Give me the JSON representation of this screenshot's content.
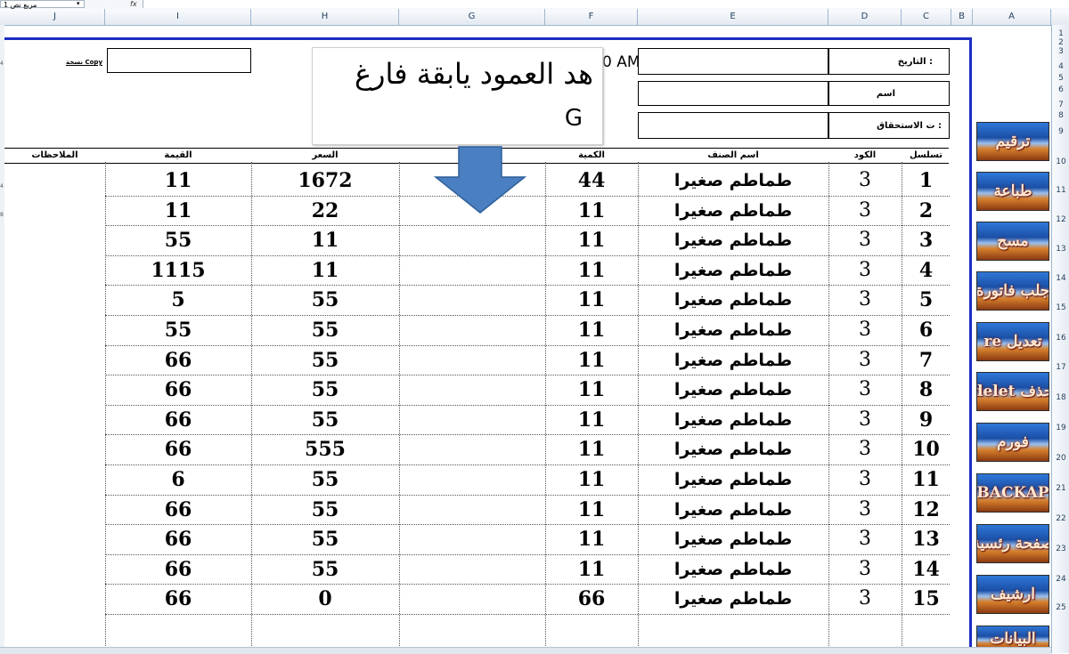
{
  "formula_bar": {
    "name_box": "مربع نص 1",
    "fx": "fx"
  },
  "columns": [
    "J",
    "I",
    "H",
    "G",
    "F",
    "E",
    "D",
    "C",
    "B",
    "A"
  ],
  "rows": [
    "1",
    "2",
    "3",
    "4",
    "5",
    "6",
    "7",
    "8",
    "9",
    "10",
    "11",
    "12",
    "13",
    "14",
    "15",
    "16",
    "17",
    "18",
    "19",
    "20",
    "21",
    "22",
    "23",
    "24",
    "25"
  ],
  "left_markers": [
    "4",
    "4",
    "8"
  ],
  "header": {
    "date_label": "التاريخ :",
    "name_label": "اسم",
    "due_label": "ت الاستحقاق :",
    "time_text": "0 AM",
    "copy_label": "نسخة Copy"
  },
  "callout": {
    "line1": "هد العمود يابقة فارغ",
    "line2": "G"
  },
  "table": {
    "headers": {
      "serial": "تسلسل",
      "code": "الكود",
      "item": "اسم الصنف",
      "qty": "الكمية",
      "price": "السعر",
      "value": "القيمة",
      "notes": "الملاحظات"
    },
    "rows": [
      {
        "serial": "1",
        "code": "3",
        "item": "طماطم صغيرا",
        "qty": "44",
        "price": "1672",
        "value": "11"
      },
      {
        "serial": "2",
        "code": "3",
        "item": "طماطم صغيرا",
        "qty": "11",
        "price": "22",
        "value": "11"
      },
      {
        "serial": "3",
        "code": "3",
        "item": "طماطم صغيرا",
        "qty": "11",
        "price": "11",
        "value": "55"
      },
      {
        "serial": "4",
        "code": "3",
        "item": "طماطم صغيرا",
        "qty": "11",
        "price": "11",
        "value": "1115"
      },
      {
        "serial": "5",
        "code": "3",
        "item": "طماطم صغيرا",
        "qty": "11",
        "price": "55",
        "value": "5"
      },
      {
        "serial": "6",
        "code": "3",
        "item": "طماطم صغيرا",
        "qty": "11",
        "price": "55",
        "value": "55"
      },
      {
        "serial": "7",
        "code": "3",
        "item": "طماطم صغيرا",
        "qty": "11",
        "price": "55",
        "value": "66"
      },
      {
        "serial": "8",
        "code": "3",
        "item": "طماطم صغيرا",
        "qty": "11",
        "price": "55",
        "value": "66"
      },
      {
        "serial": "9",
        "code": "3",
        "item": "طماطم صغيرا",
        "qty": "11",
        "price": "55",
        "value": "66"
      },
      {
        "serial": "10",
        "code": "3",
        "item": "طماطم صغيرا",
        "qty": "11",
        "price": "555",
        "value": "66"
      },
      {
        "serial": "11",
        "code": "3",
        "item": "طماطم صغيرا",
        "qty": "11",
        "price": "55",
        "value": "6"
      },
      {
        "serial": "12",
        "code": "3",
        "item": "طماطم صغيرا",
        "qty": "11",
        "price": "55",
        "value": "66"
      },
      {
        "serial": "13",
        "code": "3",
        "item": "طماطم صغيرا",
        "qty": "11",
        "price": "55",
        "value": "66"
      },
      {
        "serial": "14",
        "code": "3",
        "item": "طماطم صغيرا",
        "qty": "11",
        "price": "55",
        "value": "66"
      },
      {
        "serial": "15",
        "code": "3",
        "item": "طماطم صغيرا",
        "qty": "66",
        "price": "0",
        "value": "66"
      }
    ]
  },
  "side_buttons": [
    {
      "label": "ترقيم"
    },
    {
      "label": "طباعة"
    },
    {
      "label": "مسح"
    },
    {
      "label": "جلب فاتورة"
    },
    {
      "label": "re تعديل"
    },
    {
      "label": "delet حذف"
    },
    {
      "label": "فورم"
    },
    {
      "label": "BACKAP"
    },
    {
      "label": "صفحة رئسية"
    },
    {
      "label": "ارشيف"
    },
    {
      "label": "البيانات"
    }
  ],
  "colors": {
    "page_border": "#1d2dc4",
    "button_blue": "#1b4fa6",
    "arrow": "#4a7fc1"
  }
}
